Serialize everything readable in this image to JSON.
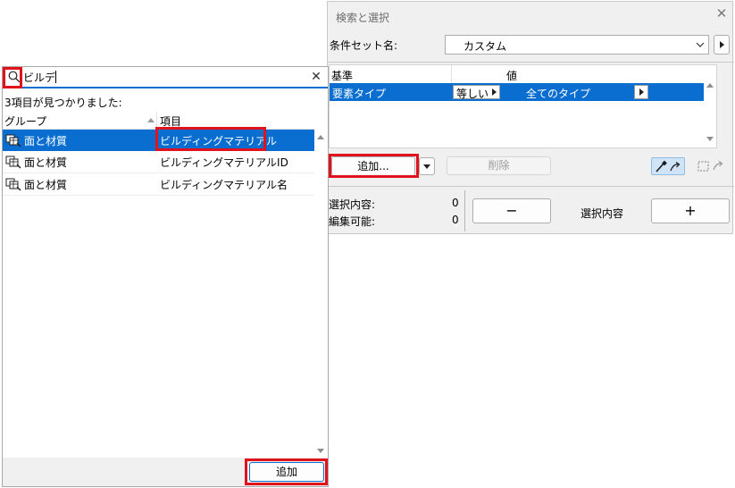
{
  "dialog": {
    "title": "検索と選択",
    "criteria_set_label": "条件セット名:",
    "criteria_set_value": "カスタム",
    "table": {
      "headers": [
        "基準",
        "値"
      ],
      "rows": [
        {
          "criterion": "要素タイプ",
          "operator": "等しい",
          "value": "全てのタイプ",
          "selected": true
        }
      ]
    },
    "add_button": "追加...",
    "delete_button": "削除",
    "selection_content_label": "選択内容:",
    "selection_content_value": "0",
    "editable_label": "編集可能:",
    "editable_value": "0",
    "minus_button": "−",
    "selection_center_label": "選択内容",
    "plus_button": "+"
  },
  "search_panel": {
    "query": "ビルデ",
    "result_count": "3項目が見つかりました:",
    "columns": [
      "グループ",
      "項目"
    ],
    "rows": [
      {
        "group": "面と材質",
        "item": "ビルディングマテリアル",
        "selected": true
      },
      {
        "group": "面と材質",
        "item": "ビルディングマテリアルID",
        "selected": false
      },
      {
        "group": "面と材質",
        "item": "ビルディングマテリアル名",
        "selected": false
      }
    ],
    "add_button": "追加"
  },
  "colors": {
    "selection": "#0a6ed1",
    "highlight_outline": "#e0121c",
    "dialog_bg": "#f0f0f0"
  }
}
